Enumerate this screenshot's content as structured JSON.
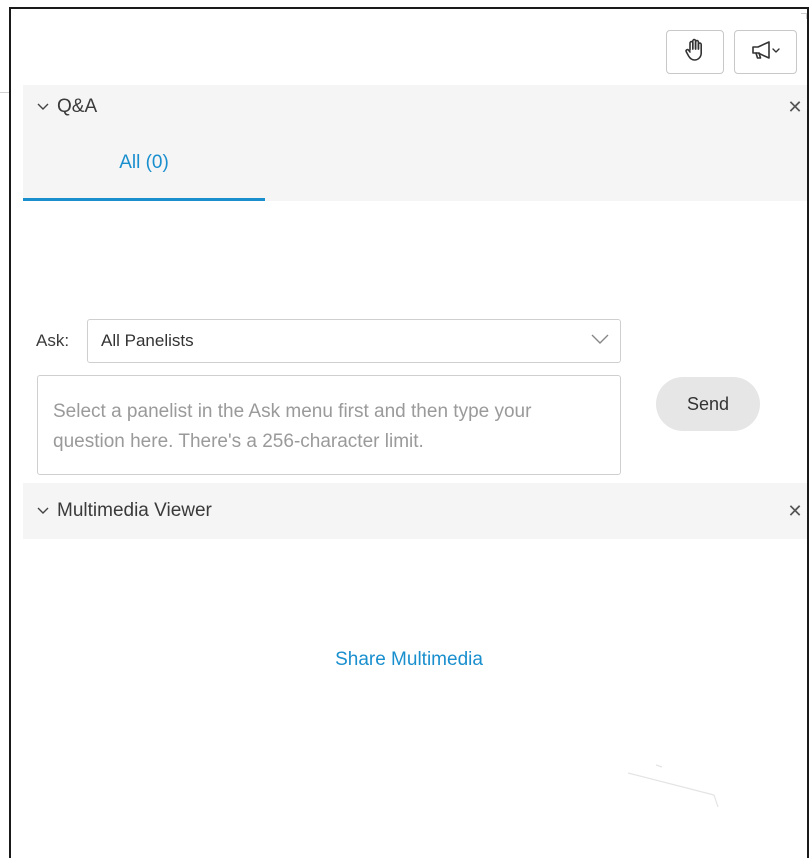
{
  "toolbar": {
    "raise_hand_icon": "raise-hand-icon",
    "announce_icon": "megaphone-icon"
  },
  "qa": {
    "title": "Q&A",
    "tabs": [
      {
        "label": "All (0)",
        "selected": true
      }
    ],
    "ask_label": "Ask:",
    "ask_selected": "All Panelists",
    "question_placeholder": "Select a panelist in the Ask menu first and then type your question here. There's a 256-character limit.",
    "send_label": "Send"
  },
  "multimedia": {
    "title": "Multimedia Viewer",
    "share_label": "Share Multimedia"
  },
  "colors": {
    "accent": "#1a8fce",
    "header_bg": "#f5f5f5",
    "send_bg": "#e6e6e6"
  }
}
